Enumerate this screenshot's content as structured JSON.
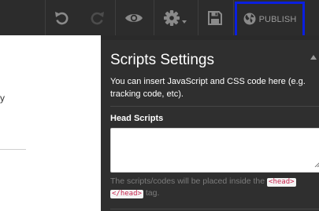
{
  "toolbar": {
    "undo_icon": "undo-icon",
    "redo_icon": "redo-icon",
    "preview_icon": "eye-icon",
    "settings_icon": "gear-icon",
    "save_icon": "floppy-disk-icon",
    "publish_icon": "globe-icon",
    "publish_label": "PUBLISH",
    "publish_highlight_color": "#0a1fe0"
  },
  "canvas": {
    "partial_text": "y"
  },
  "panel": {
    "title": "Scripts Settings",
    "description": "You can insert JavaScript and CSS code here (e.g. tracking code, etc).",
    "head_scripts": {
      "label": "Head Scripts",
      "value": "",
      "hint_before": "The scripts/codes will be placed inside the",
      "hint_tag_open": "<head>",
      "hint_tag_close": "</head>",
      "hint_after": "tag."
    }
  }
}
